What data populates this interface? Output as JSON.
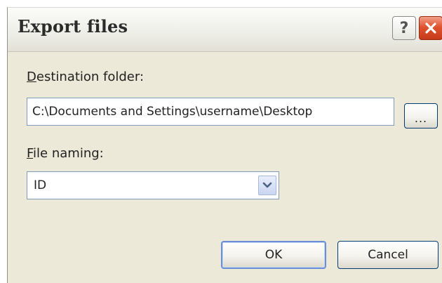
{
  "window": {
    "title": "Export files",
    "help_label": "?"
  },
  "destination": {
    "label_access": "D",
    "label_rest": "estination folder:",
    "value": "C:\\Documents and Settings\\username\\Desktop",
    "browse_label": "..."
  },
  "naming": {
    "label_access": "F",
    "label_rest": "ile naming:",
    "selected": "ID"
  },
  "buttons": {
    "ok_label": "OK",
    "cancel_label": "Cancel"
  },
  "colors": {
    "dialog_bg": "#ece9d8",
    "close_red": "#e0532e",
    "input_border": "#7f9db9",
    "button_border": "#003c74"
  },
  "icons": {
    "close": "close-x-icon",
    "dropdown": "chevron-down-icon"
  }
}
